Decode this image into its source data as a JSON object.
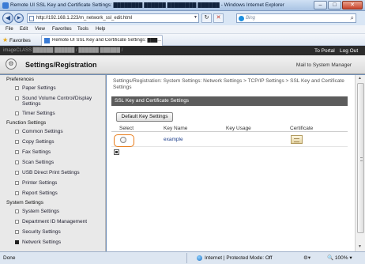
{
  "window": {
    "title": "Remote UI SSL Key and Certificate Settings: ████████ ██████ ████████ ██████ - Windows Internet Explorer",
    "minimize": "–",
    "maximize": "□",
    "close": "✕"
  },
  "address": {
    "url": "http://192.168.1.223/m_network_ssl_edit.html",
    "search_placeholder": "Bing"
  },
  "menu": [
    "File",
    "Edit",
    "View",
    "Favorites",
    "Tools",
    "Help"
  ],
  "favorites": {
    "label": "Favorites",
    "tab_title": "Remote UI SSL Key and Certificate Settings: ███..."
  },
  "device": {
    "model": "imageCLASS ██████ ██████ / ██████ ██████ /",
    "to_portal": "To Portal",
    "log_out": "Log Out"
  },
  "header": {
    "title": "Settings/Registration",
    "mail": "Mail to System Manager"
  },
  "sidebar": {
    "sections": [
      {
        "title": "Preferences",
        "items": [
          "Paper Settings",
          "Sound Volume Control/Display Settings",
          "Timer Settings"
        ]
      },
      {
        "title": "Function Settings",
        "items": [
          "Common Settings",
          "Copy Settings",
          "Fax Settings",
          "Scan Settings",
          "USB Direct Print Settings",
          "Printer Settings",
          "Report Settings"
        ]
      },
      {
        "title": "System Settings",
        "items": [
          "System Settings",
          "Department ID Management",
          "Security Settings",
          "Network Settings"
        ]
      }
    ]
  },
  "main": {
    "breadcrumb": "Settings/Registration: System Settings: Network Settings > TCP/IP Settings > SSL Key and Certificate Settings",
    "section_title": "SSL Key and Certificate Settings",
    "default_button": "Default Key Settings",
    "columns": [
      "Select",
      "Key Name",
      "Key Usage",
      "Certificate"
    ],
    "rows": [
      {
        "key_name": "example",
        "key_usage": ""
      }
    ]
  },
  "status": {
    "text": "Done",
    "zone": "Internet | Protected Mode: Off",
    "zoom": "100%"
  },
  "colors": {
    "highlight": "#e87b18",
    "section_header": "#5c5c5c",
    "device_bar": "#2c2c2c"
  }
}
